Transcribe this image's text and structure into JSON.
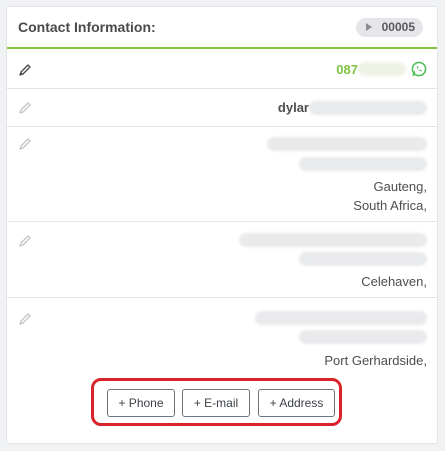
{
  "header": {
    "title": "Contact Information:",
    "id_badge": "00005"
  },
  "rows": {
    "phone": {
      "visible_prefix": "087"
    },
    "name": {
      "visible_prefix": "dylar"
    },
    "address1": {
      "lines": [
        "Gauteng,",
        "South Africa,"
      ]
    },
    "address2": {
      "lines": [
        "Celehaven,"
      ]
    },
    "address3": {
      "lines": [
        "Port Gerhardside,"
      ]
    }
  },
  "actions": {
    "phone_label": "+ Phone",
    "email_label": "+ E-mail",
    "address_label": "+ Address"
  },
  "colors": {
    "accent": "#7fc241",
    "highlight": "#d8232a"
  },
  "icons": {
    "edit": "pencil-icon",
    "whatsapp": "whatsapp-icon",
    "badge": "play-icon"
  }
}
